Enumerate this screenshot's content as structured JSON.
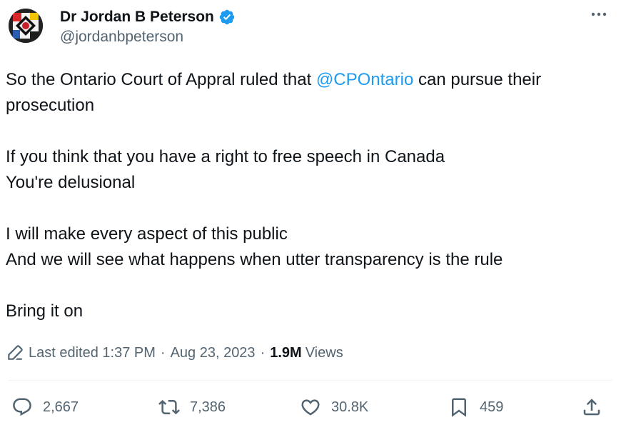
{
  "author": {
    "display_name": "Dr Jordan B Peterson",
    "handle": "@jordanbpeterson",
    "verified": true
  },
  "tweet": {
    "line1_before": "So the Ontario Court of Appral ruled that ",
    "mention": "@CPOntario",
    "line1_after": " can pursue their prosecution",
    "line2": "If you think that you have a right to free speech in Canada",
    "line3": "You're delusional",
    "line4": "I will make every aspect of this public",
    "line5": "And we will see what happens when utter transparency is the rule",
    "line6": "Bring it on"
  },
  "meta": {
    "edited_label": "Last edited 1:37 PM",
    "separator": "·",
    "date": "Aug 23, 2023",
    "views_count": "1.9M",
    "views_label": "Views"
  },
  "actions": {
    "replies": "2,667",
    "reposts": "7,386",
    "likes": "30.8K",
    "bookmarks": "459"
  },
  "colors": {
    "accent": "#1d9bf0",
    "text": "#0f1419",
    "secondary": "#536471"
  },
  "icons": [
    "verified-badge-icon",
    "more-icon",
    "edit-pencil-icon",
    "reply-icon",
    "repost-icon",
    "like-icon",
    "bookmark-icon",
    "share-icon"
  ]
}
